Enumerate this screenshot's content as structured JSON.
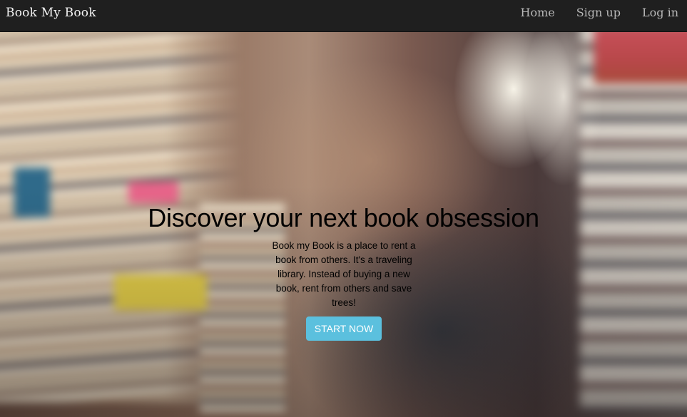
{
  "navbar": {
    "brand": "Book My Book",
    "links": [
      {
        "label": "Home"
      },
      {
        "label": "Sign up"
      },
      {
        "label": "Log in"
      }
    ]
  },
  "hero": {
    "headline": "Discover your next book obsession",
    "description": "Book my Book is a place to rent a book from others. It's a traveling library. Instead of buying a new book, rent from others and save trees!",
    "cta_label": "START NOW",
    "cta_color": "#5bc0de"
  },
  "colors": {
    "navbar_bg": "#1f1f1f",
    "brand_text": "#f2f2f2",
    "nav_link_text": "#b8b8b8",
    "headline_text": "#000000"
  }
}
